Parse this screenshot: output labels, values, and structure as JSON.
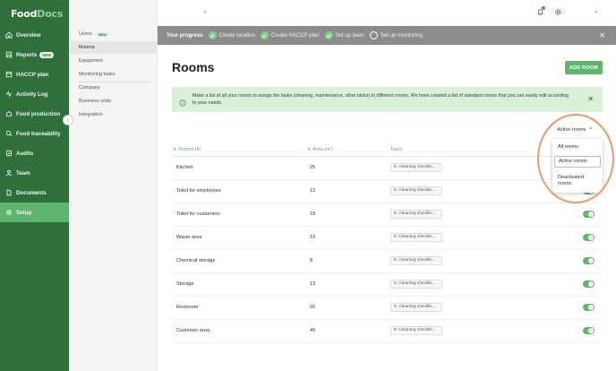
{
  "brand": {
    "logo_text_a": "Food",
    "logo_text_b": "Docs"
  },
  "sidebar": {
    "items": [
      {
        "label": "Overview",
        "icon": "home-icon"
      },
      {
        "label": "Reports",
        "icon": "reports-icon",
        "badge": "NEW"
      },
      {
        "label": "HACCP plan",
        "icon": "haccp-icon"
      },
      {
        "label": "Activity Log",
        "icon": "activity-icon"
      },
      {
        "label": "Food production",
        "icon": "production-icon"
      },
      {
        "label": "Food traceability",
        "icon": "traceability-icon"
      },
      {
        "label": "Audits",
        "icon": "audits-icon"
      },
      {
        "label": "Team",
        "icon": "team-icon"
      },
      {
        "label": "Documents",
        "icon": "documents-icon"
      },
      {
        "label": "Setup",
        "icon": "gear-icon",
        "active": true
      }
    ]
  },
  "subnav": {
    "items": [
      {
        "label": "Users",
        "badge": "NEW"
      },
      {
        "label": "Rooms",
        "active": true
      },
      {
        "label": "Equipment"
      },
      {
        "label": "Monitoring tasks"
      },
      {
        "label": "Company"
      },
      {
        "label": "Business units"
      },
      {
        "label": "Integration"
      }
    ]
  },
  "progress": {
    "label": "Your progress",
    "steps": [
      {
        "label": "Create location",
        "done": true
      },
      {
        "label": "Create HACCP plan",
        "done": true
      },
      {
        "label": "Set up team",
        "done": true
      },
      {
        "label": "Set up monitoring",
        "done": false
      }
    ],
    "close": "✕"
  },
  "page": {
    "title": "Rooms",
    "add_button": "ADD ROOM",
    "info_text": "Make a list of all your rooms to assign the tasks (cleaning, maintenance, other tasks) to different rooms. We have created a list of standard rooms that you can easily edit according to your needs.",
    "info_close": "✕"
  },
  "filter": {
    "selected": "Active rooms",
    "options": [
      "All rooms",
      "Active rooms",
      "Deactivated rooms"
    ]
  },
  "table": {
    "columns": {
      "rooms": "Rooms (8)",
      "area": "Area (m²)",
      "tasks": "Tasks"
    },
    "rows": [
      {
        "name": "Kitchen",
        "area": "25",
        "task": "8. Cleaning checklis..."
      },
      {
        "name": "Toilet for employees",
        "area": "12",
        "task": "8. Cleaning checklis..."
      },
      {
        "name": "Toilet for customers",
        "area": "18",
        "task": "8. Cleaning checklis..."
      },
      {
        "name": "Waste area",
        "area": "10",
        "task": "8. Cleaning checklis..."
      },
      {
        "name": "Chemical storage",
        "area": "8",
        "task": "8. Cleaning checklis..."
      },
      {
        "name": "Storage",
        "area": "13",
        "task": "8. Cleaning checklis..."
      },
      {
        "name": "Restroom",
        "area": "20",
        "task": "8. Cleaning checklis..."
      },
      {
        "name": "Customer area",
        "area": "40",
        "task": "8. Cleaning checklis..."
      }
    ]
  },
  "colors": {
    "sidebar": "#2e6f3c",
    "accent": "#5eb56d",
    "info_bg": "#dbf0d9",
    "progress_bg": "#8c8c8c",
    "highlight": "#e89a6a"
  }
}
